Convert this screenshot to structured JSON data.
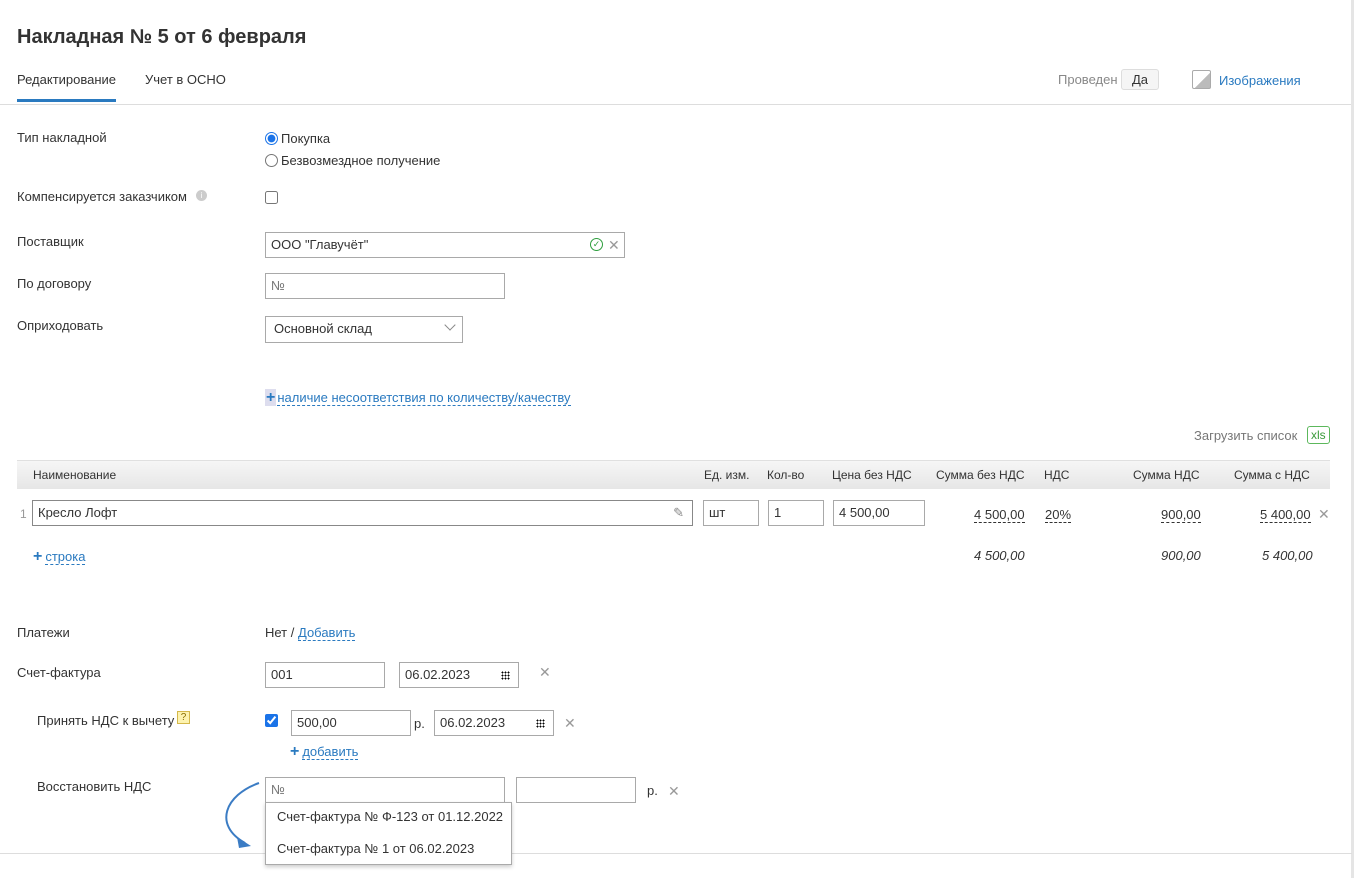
{
  "title": "Накладная № 5 от 6 февраля",
  "tabs": [
    {
      "label": "Редактирование"
    },
    {
      "label": "Учет в ОСНО"
    }
  ],
  "header": {
    "posted_label": "Проведен",
    "posted_value": "Да",
    "images_link": "Изображения"
  },
  "form": {
    "type_label": "Тип накладной",
    "type_options": [
      "Покупка",
      "Безвозмездное получение"
    ],
    "compensated_label": "Компенсируется заказчиком",
    "supplier_label": "Поставщик",
    "supplier_value": "ООО \"Главучёт\"",
    "contract_label": "По договору",
    "contract_placeholder": "№",
    "receive_label": "Оприходовать",
    "warehouse_value": "Основной склад",
    "mismatch_link": "наличие несоответствия по количеству/качеству"
  },
  "upload": {
    "label": "Загрузить список",
    "xls": "xls"
  },
  "table": {
    "headers": [
      "Наименование",
      "Ед. изм.",
      "Кол-во",
      "Цена без НДС",
      "Сумма без НДС",
      "НДС",
      "Сумма НДС",
      "Сумма с НДС"
    ],
    "rows": [
      {
        "num": "1",
        "name": "Кресло Лофт",
        "unit": "шт",
        "qty": "1",
        "price": "4 500,00",
        "sum": "4 500,00",
        "vat": "20%",
        "vat_sum": "900,00",
        "total": "5 400,00"
      }
    ],
    "add_row": "строка",
    "totals": {
      "sum": "4 500,00",
      "vat_sum": "900,00",
      "total": "5 400,00"
    }
  },
  "payments": {
    "label": "Платежи",
    "none": "Нет /",
    "add": "Добавить"
  },
  "invoice": {
    "label": "Счет-фактура",
    "number": "001",
    "date": "06.02.2023"
  },
  "vat_deduct": {
    "label": "Принять НДС к вычету",
    "help": "?",
    "amount": "500,00",
    "currency": "р.",
    "date": "06.02.2023",
    "add": "добавить"
  },
  "vat_restore": {
    "label": "Восстановить НДС",
    "placeholder": "№",
    "currency": "р.",
    "options": [
      "Счет-фактура № Ф-123 от 01.12.2022",
      "Счет-фактура № 1 от 06.02.2023"
    ]
  }
}
